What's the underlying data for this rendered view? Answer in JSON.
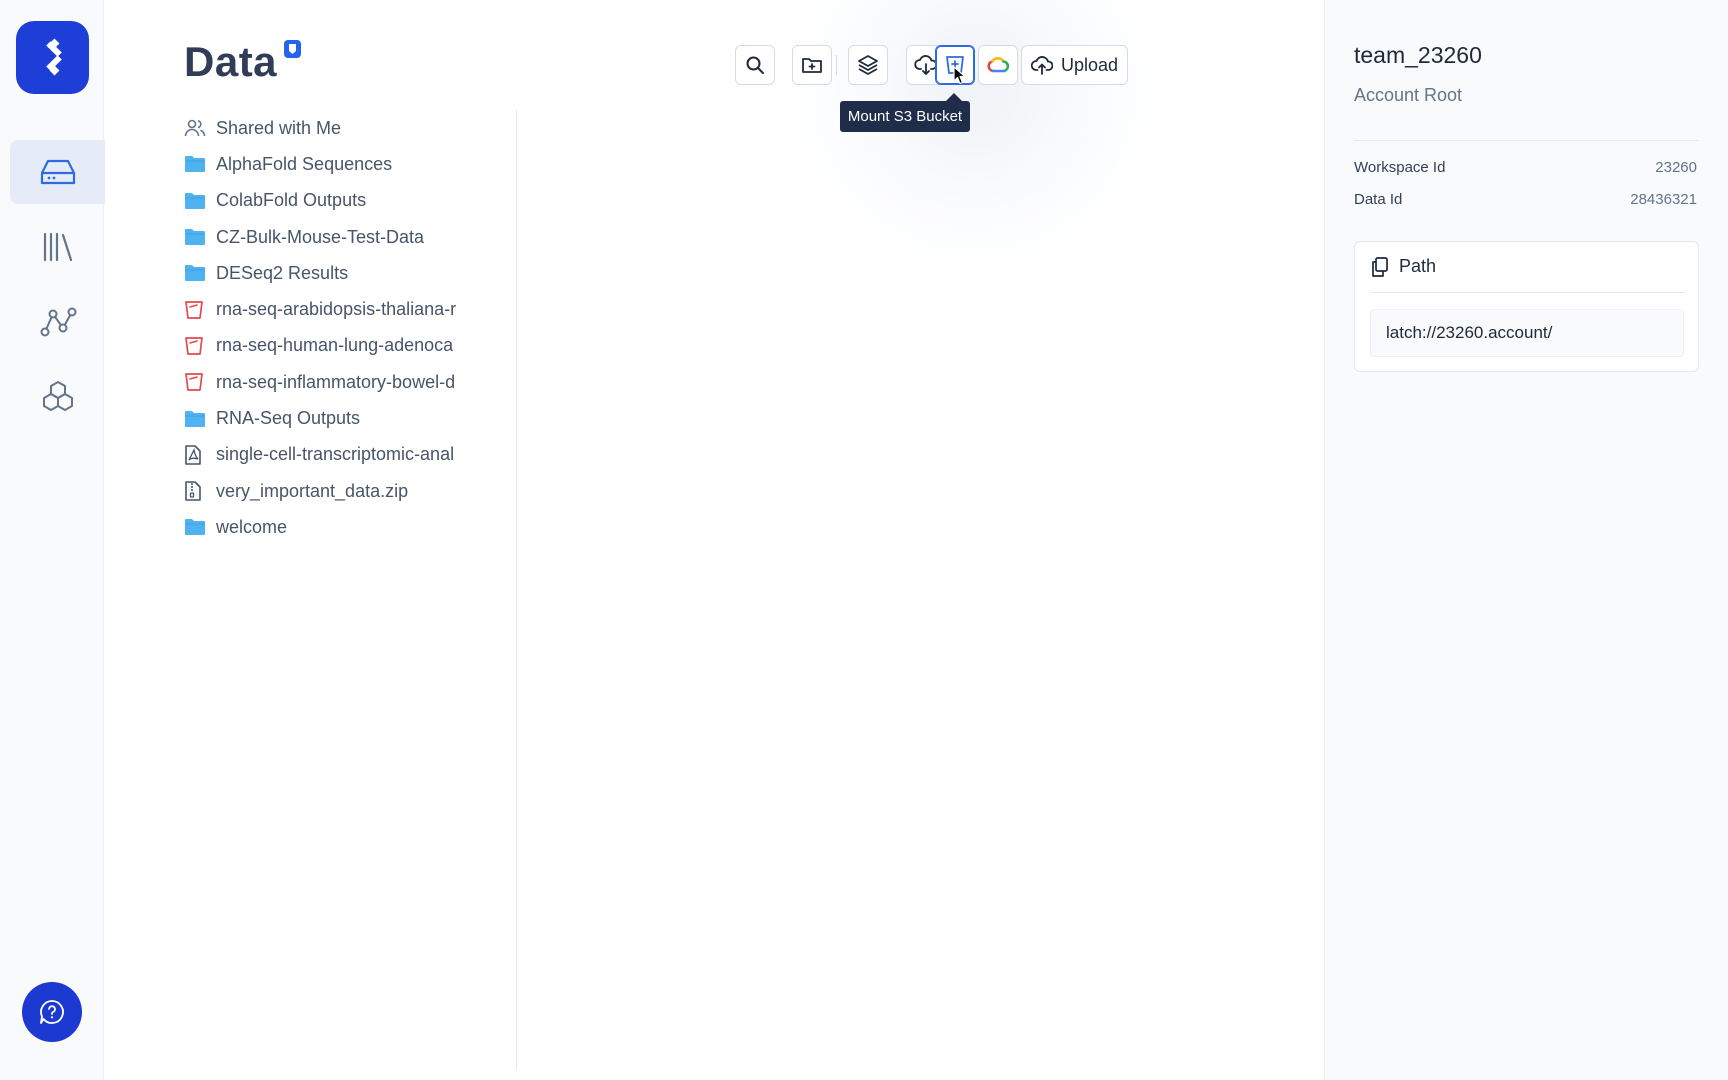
{
  "rail": {
    "items": [
      {
        "icon": "hard-drive-icon",
        "active": true
      },
      {
        "icon": "library-icon",
        "active": false
      },
      {
        "icon": "workflow-graph-icon",
        "active": false
      },
      {
        "icon": "hexagons-icon",
        "active": false
      }
    ],
    "help_icon": "help-chat-icon"
  },
  "main": {
    "title": "Data",
    "toolbar": {
      "upload_label": "Upload",
      "tooltip": "Mount S3 Bucket"
    },
    "files": [
      {
        "icon": "users-icon",
        "label": "Shared with Me"
      },
      {
        "icon": "folder-icon",
        "label": "AlphaFold Sequences"
      },
      {
        "icon": "folder-icon",
        "label": "ColabFold Outputs"
      },
      {
        "icon": "folder-icon",
        "label": "CZ-Bulk-Mouse-Test-Data"
      },
      {
        "icon": "folder-icon",
        "label": "DESeq2 Results"
      },
      {
        "icon": "s3-bucket-icon",
        "label": "rna-seq-arabidopsis-thaliana-r"
      },
      {
        "icon": "s3-bucket-icon",
        "label": "rna-seq-human-lung-adenoca"
      },
      {
        "icon": "s3-bucket-icon",
        "label": "rna-seq-inflammatory-bowel-d"
      },
      {
        "icon": "folder-icon",
        "label": "RNA-Seq Outputs"
      },
      {
        "icon": "pdf-file-icon",
        "label": "single-cell-transcriptomic-anal"
      },
      {
        "icon": "zip-file-icon",
        "label": "very_important_data.zip"
      },
      {
        "icon": "folder-icon",
        "label": "welcome"
      }
    ]
  },
  "info": {
    "team_name": "team_23260",
    "subtitle": "Account Root",
    "workspace_id_label": "Workspace Id",
    "workspace_id": "23260",
    "data_id_label": "Data Id",
    "data_id": "28436321",
    "path_label": "Path",
    "path_value": "latch://23260.account/"
  },
  "colors": {
    "brand": "#1d3fd8",
    "accent": "#2f6be0",
    "folder": "#4fb3ef",
    "bucket": "#e5484d"
  }
}
